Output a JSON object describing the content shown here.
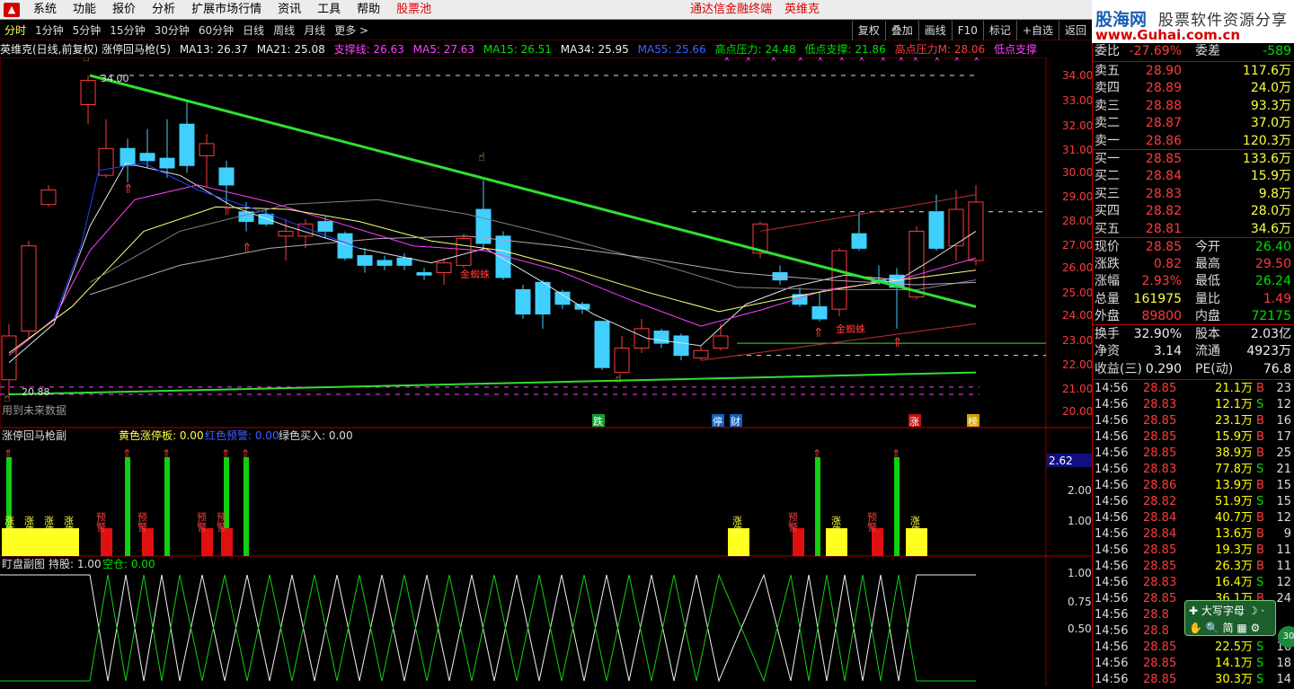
{
  "menubar": {
    "items": [
      "系统",
      "功能",
      "报价",
      "分析",
      "扩展市场行情",
      "资讯",
      "工具",
      "帮助"
    ],
    "stock_pool": "股票池",
    "app_title": "通达信金融终端",
    "stock_name": "英维克"
  },
  "brand": {
    "cn": "股海网",
    "slogan": "股票软件资源分享",
    "url": "www.Guhai.com.cn"
  },
  "toolbar": {
    "periods": [
      "分时",
      "1分钟",
      "5分钟",
      "15分钟",
      "30分钟",
      "60分钟",
      "日线",
      "周线",
      "月线",
      "更多 >"
    ],
    "active_period": "日线",
    "right_buttons": [
      "复权",
      "叠加",
      "画线",
      "F10",
      "标记",
      "+自选",
      "返回"
    ]
  },
  "infoline": {
    "title": "英维克(日线,前复权) 涨停回马枪(5)",
    "ma13": "MA13: 26.37",
    "ma21": "MA21: 25.08",
    "support": "支撑线: 26.63",
    "ma5": "MA5: 27.63",
    "ma15": "MA15: 26.51",
    "ma34": "MA34: 25.95",
    "ma55": "MA55: 25.66",
    "high_press": "高点压力: 24.48",
    "low_support": "低点支撑: 21.86",
    "high_press_m": "高点压力M: 28.06",
    "low_support2": "低点支撑"
  },
  "main_chart": {
    "y_labels": [
      "34.00",
      "33.00",
      "32.00",
      "31.00",
      "30.00",
      "29.00",
      "28.00",
      "27.00",
      "26.00",
      "25.00",
      "24.00",
      "23.00",
      "22.00",
      "21.00",
      "20.00"
    ],
    "high_label": "34.00",
    "low_label": "20.88",
    "future_data": "用到未来数据",
    "signal_golden": "金蜘蛛",
    "bottom_tags": [
      "跌",
      "停",
      "财",
      "涨",
      "榜"
    ]
  },
  "sub1": {
    "title": "涨停回马枪副",
    "yellow": "黄色涨停板: 0.00",
    "red": "红色预警: 0.00",
    "green": "绿色买入: 0.00",
    "y_labels": [
      "2.62",
      "2.00",
      "1.00"
    ],
    "zt": "涨停",
    "yj": "预警"
  },
  "sub2": {
    "title": "盯盘副图",
    "hold": "持股: 1.00",
    "empty": "空仓: 0.00",
    "y_labels": [
      "1.00",
      "0.75",
      "0.50"
    ]
  },
  "quote": {
    "webi_label": "委比",
    "webi_val": "-27.69%",
    "weicha_label": "委差",
    "weicha_val": "-589",
    "sell": [
      {
        "label": "卖五",
        "price": "28.90",
        "vol": "117.6万"
      },
      {
        "label": "卖四",
        "price": "28.89",
        "vol": "24.0万"
      },
      {
        "label": "卖三",
        "price": "28.88",
        "vol": "93.3万"
      },
      {
        "label": "卖二",
        "price": "28.87",
        "vol": "37.0万"
      },
      {
        "label": "卖一",
        "price": "28.86",
        "vol": "120.3万"
      }
    ],
    "buy": [
      {
        "label": "买一",
        "price": "28.85",
        "vol": "133.6万"
      },
      {
        "label": "买二",
        "price": "28.84",
        "vol": "15.9万"
      },
      {
        "label": "买三",
        "price": "28.83",
        "vol": "9.8万"
      },
      {
        "label": "买四",
        "price": "28.82",
        "vol": "28.0万"
      },
      {
        "label": "买五",
        "price": "28.81",
        "vol": "34.6万"
      }
    ],
    "stats": [
      {
        "l1": "现价",
        "v1": "28.85",
        "c1": "red",
        "l2": "今开",
        "v2": "26.40",
        "c2": "grn"
      },
      {
        "l1": "涨跌",
        "v1": "0.82",
        "c1": "red",
        "l2": "最高",
        "v2": "29.50",
        "c2": "red"
      },
      {
        "l1": "涨幅",
        "v1": "2.93%",
        "c1": "red",
        "l2": "最低",
        "v2": "26.24",
        "c2": "grn"
      },
      {
        "l1": "总量",
        "v1": "161975",
        "c1": "yel",
        "l2": "量比",
        "v2": "1.49",
        "c2": "red"
      },
      {
        "l1": "外盘",
        "v1": "89800",
        "c1": "red",
        "l2": "内盘",
        "v2": "72175",
        "c2": "grn"
      }
    ],
    "stats2": [
      {
        "l1": "换手",
        "v1": "32.90%",
        "l2": "股本",
        "v2": "2.03亿"
      },
      {
        "l1": "净资",
        "v1": "3.14",
        "l2": "流通",
        "v2": "4923万"
      },
      {
        "l1": "收益(三)",
        "v1": "0.290",
        "l2": "PE(动)",
        "v2": "76.8"
      }
    ]
  },
  "ticks": [
    {
      "t": "14:56",
      "p": "28.85",
      "v": "21.1万",
      "d": "B",
      "n": "23"
    },
    {
      "t": "14:56",
      "p": "28.83",
      "v": "12.1万",
      "d": "S",
      "n": "12"
    },
    {
      "t": "14:56",
      "p": "28.85",
      "v": "23.1万",
      "d": "B",
      "n": "16"
    },
    {
      "t": "14:56",
      "p": "28.85",
      "v": "15.9万",
      "d": "B",
      "n": "17"
    },
    {
      "t": "14:56",
      "p": "28.85",
      "v": "38.9万",
      "d": "B",
      "n": "25"
    },
    {
      "t": "14:56",
      "p": "28.83",
      "v": "77.8万",
      "d": "S",
      "n": "21"
    },
    {
      "t": "14:56",
      "p": "28.86",
      "v": "13.9万",
      "d": "B",
      "n": "15"
    },
    {
      "t": "14:56",
      "p": "28.82",
      "v": "51.9万",
      "d": "S",
      "n": "15"
    },
    {
      "t": "14:56",
      "p": "28.84",
      "v": "40.7万",
      "d": "B",
      "n": "12"
    },
    {
      "t": "14:56",
      "p": "28.84",
      "v": "13.6万",
      "d": "B",
      "n": "9"
    },
    {
      "t": "14:56",
      "p": "28.85",
      "v": "19.3万",
      "d": "B",
      "n": "11"
    },
    {
      "t": "14:56",
      "p": "28.85",
      "v": "26.3万",
      "d": "B",
      "n": "11"
    },
    {
      "t": "14:56",
      "p": "28.83",
      "v": "16.4万",
      "d": "S",
      "n": "12"
    },
    {
      "t": "14:56",
      "p": "28.85",
      "v": "36.1万",
      "d": "B",
      "n": "24"
    },
    {
      "t": "14:56",
      "p": "28.8",
      "v": "",
      "d": "",
      "n": ""
    },
    {
      "t": "14:56",
      "p": "28.8",
      "v": "",
      "d": "",
      "n": ""
    },
    {
      "t": "14:56",
      "p": "28.85",
      "v": "22.5万",
      "d": "S",
      "n": "16"
    },
    {
      "t": "14:56",
      "p": "28.85",
      "v": "14.1万",
      "d": "S",
      "n": "18"
    },
    {
      "t": "14:56",
      "p": "28.85",
      "v": "30.3万",
      "d": "S",
      "n": "14"
    }
  ],
  "float_kb": {
    "caps": "大写字母",
    "mode": "简",
    "badge": "30"
  }
}
